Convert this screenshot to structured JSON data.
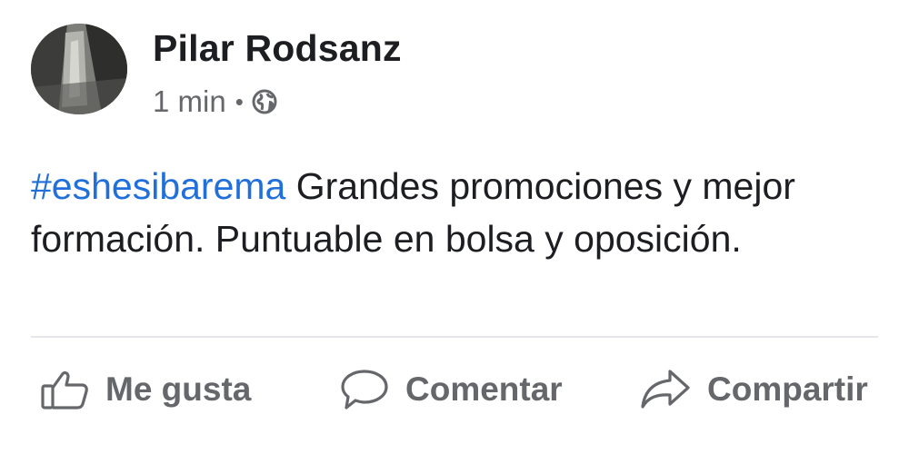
{
  "post": {
    "author": "Pilar Rodsanz",
    "time": "1 min",
    "separator": "•",
    "privacy_icon": "globe-icon",
    "hashtag": "#eshesibarema",
    "text": " Grandes promociones y mejor formación. Puntuable en bolsa y oposición."
  },
  "actions": {
    "like": {
      "label": "Me gusta",
      "icon": "thumbs-up-icon"
    },
    "comment": {
      "label": "Comentar",
      "icon": "comment-icon"
    },
    "share": {
      "label": "Compartir",
      "icon": "share-icon"
    }
  },
  "colors": {
    "hashtag": "#216fdb",
    "text": "#1c1e21",
    "secondary": "#65676b",
    "divider": "#e4e6eb"
  }
}
